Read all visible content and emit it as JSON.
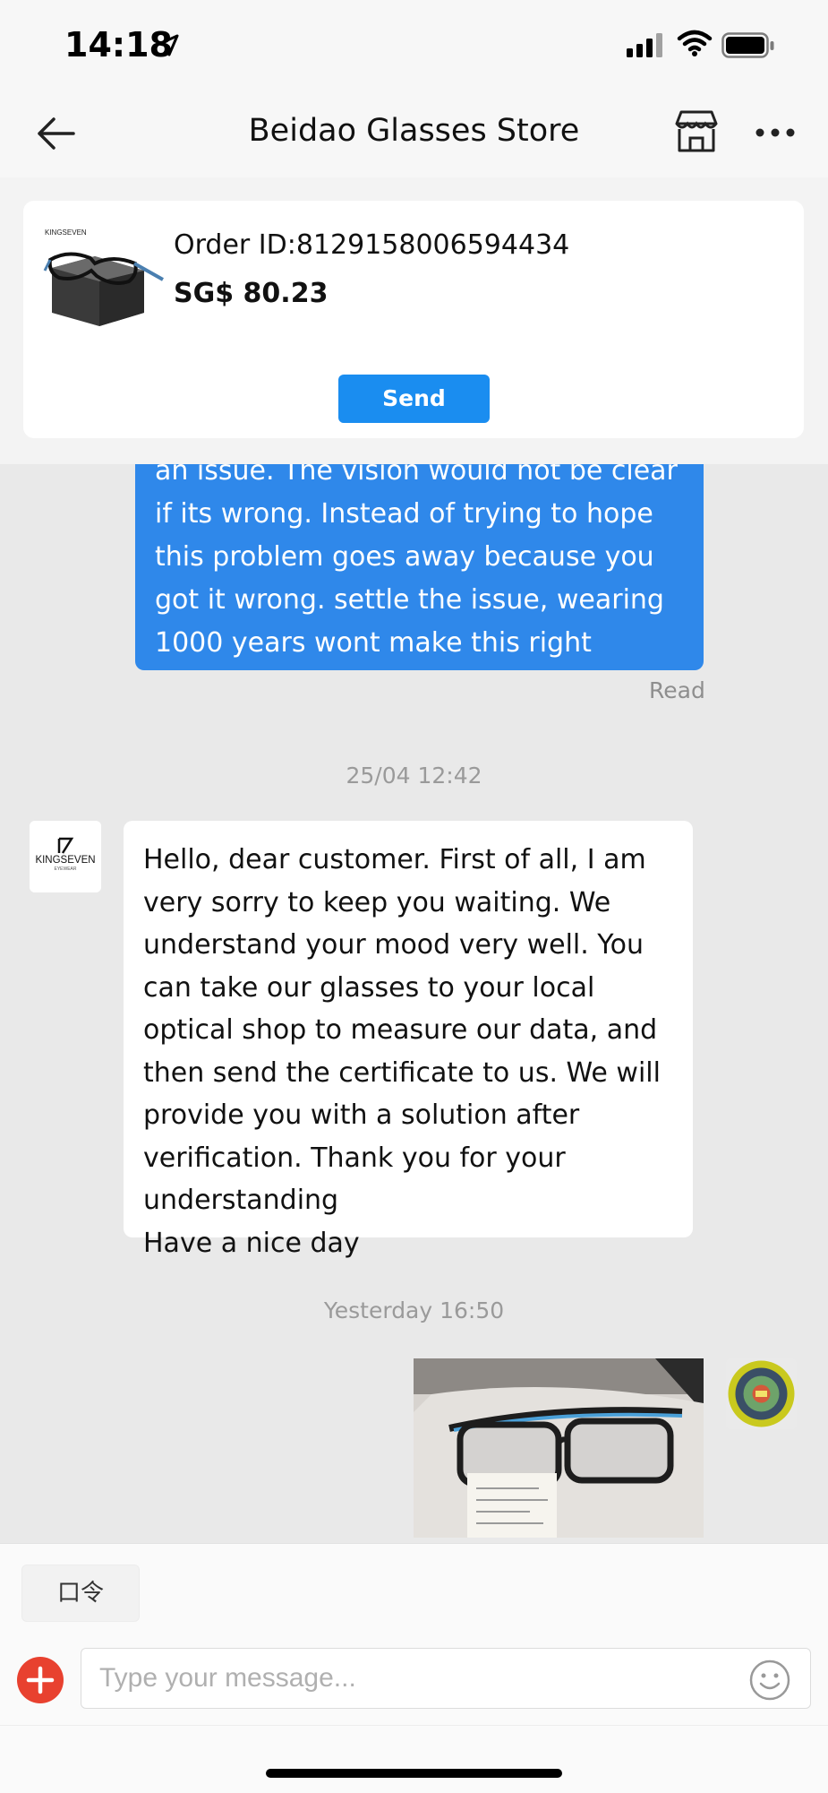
{
  "status_bar": {
    "time": "14:18"
  },
  "header": {
    "title": "Beidao Glasses Store"
  },
  "order": {
    "brand": "KINGSEVEN",
    "order_id": "Order ID:8129158006594434",
    "price": "SG$ 80.23",
    "send_label": "Send"
  },
  "messages": {
    "outgoing_text": "an issue. The vision would not be clear if its wrong. Instead of trying to hope this problem goes away because you got it wrong. settle the issue, wearing 1000 years wont make this right",
    "read_label": "Read",
    "timestamp_1": "25/04 12:42",
    "store_avatar_brand": "KINGSEVEN",
    "store_avatar_sub": "EYEWEAR",
    "incoming_text": "Hello, dear customer. First of all, I am very sorry to keep you waiting. We understand your mood very well. You can take our glasses to your local optical shop to measure our data, and then send the certificate to us. We will provide you with a solution after verification. Thank you for your understanding\nHave a nice day",
    "timestamp_2": "Yesterday 16:50"
  },
  "composer": {
    "command_label": "口令",
    "placeholder": "Type your message..."
  },
  "colors": {
    "accent": "#1a8df0",
    "outgoing_bubble": "#2f88ea",
    "add_button": "#e8412f"
  }
}
